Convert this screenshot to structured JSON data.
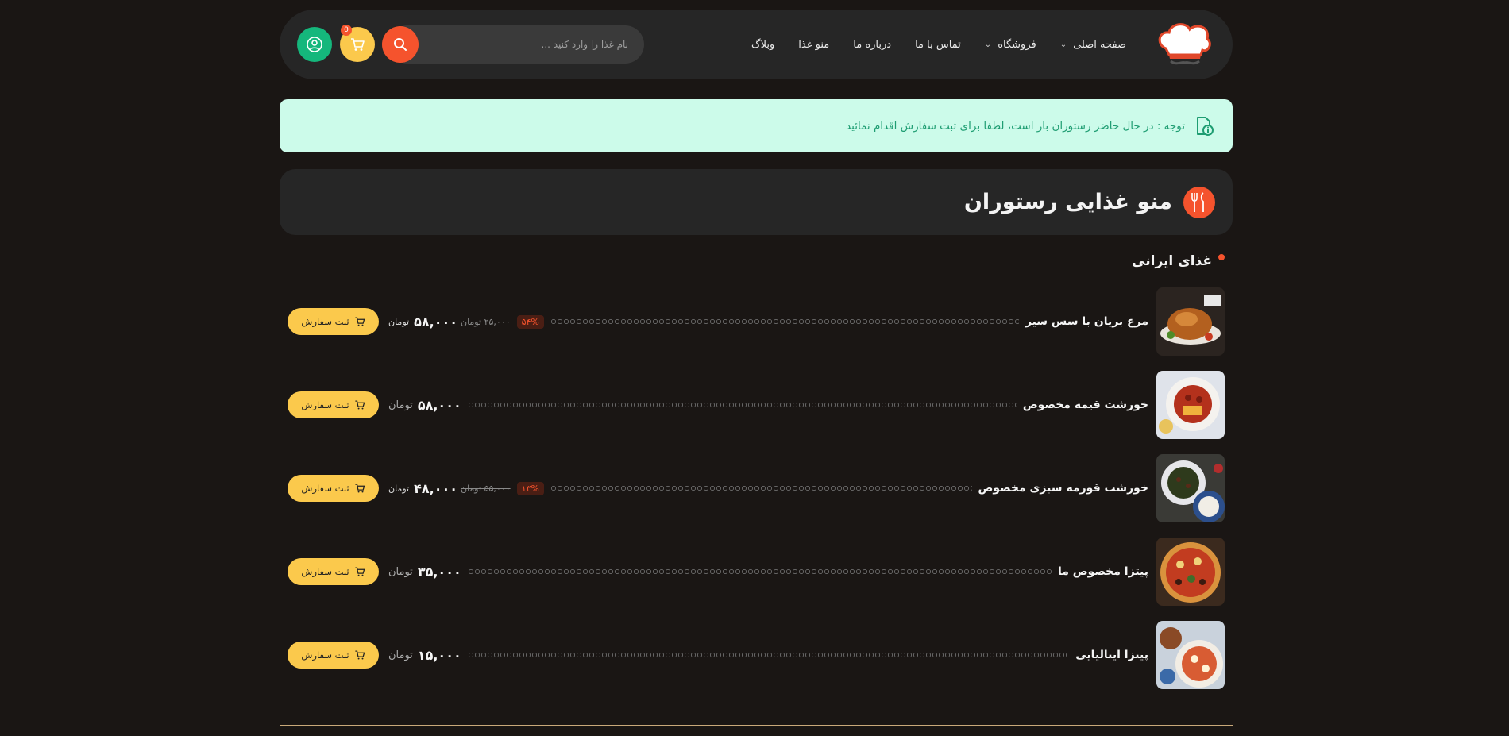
{
  "header": {
    "nav": [
      {
        "label": "صفحه اصلی",
        "has_dropdown": true
      },
      {
        "label": "فروشگاه",
        "has_dropdown": true
      },
      {
        "label": "تماس با ما",
        "has_dropdown": false
      },
      {
        "label": "درباره ما",
        "has_dropdown": false
      },
      {
        "label": "منو غذا",
        "has_dropdown": false
      },
      {
        "label": "وبلاگ",
        "has_dropdown": false
      }
    ],
    "search_placeholder": "نام غذا را وارد کنید ...",
    "cart_count": "0",
    "icons": {
      "search": "search-icon",
      "cart": "cart-icon",
      "user": "user-icon",
      "logo": "chef-hat-logo"
    }
  },
  "notice": {
    "text": "توجه : در حال حاضر رستوران باز است، لطفا برای ثبت سفارش اقدام نمائید",
    "icon": "info-doc-icon"
  },
  "menu": {
    "title": "منو غذایی رستوران",
    "section_title": "غذای ایرانی",
    "items": [
      {
        "name": "مرغ بریان با سس سیر",
        "discount": "۵۴%",
        "old_price": "۲۵,۰۰۰",
        "old_unit": "تومان",
        "price": "۵۸,۰۰۰",
        "unit": "تومان",
        "button": "ثبت سفارش",
        "image": "roast-chicken"
      },
      {
        "name": "خورشت قیمه مخصوص",
        "discount": "",
        "old_price": "",
        "old_unit": "",
        "price": "۵۸,۰۰۰",
        "unit": "تومان",
        "button": "ثبت سفارش",
        "image": "gheymeh-stew"
      },
      {
        "name": "خورشت قورمه سبزی مخصوص",
        "discount": "۱۳%",
        "old_price": "۵۵,۰۰۰",
        "old_unit": "تومان",
        "price": "۴۸,۰۰۰",
        "unit": "تومان",
        "button": "ثبت سفارش",
        "image": "ghormeh-sabzi"
      },
      {
        "name": "پیتزا مخصوص ما",
        "discount": "",
        "old_price": "",
        "old_unit": "",
        "price": "۳۵,۰۰۰",
        "unit": "تومان",
        "button": "ثبت سفارش",
        "image": "special-pizza"
      },
      {
        "name": "پیتزا ایتالیایی",
        "discount": "",
        "old_price": "",
        "old_unit": "",
        "price": "۱۵,۰۰۰",
        "unit": "تومان",
        "button": "ثبت سفارش",
        "image": "italian-pizza"
      }
    ]
  },
  "colors": {
    "background": "#1a1614",
    "panel": "#262626",
    "accent_orange": "#f5532d",
    "accent_yellow": "#fbc94c",
    "accent_green": "#15b77c",
    "notice_bg": "#ccfbea",
    "notice_text": "#1e9d72"
  }
}
